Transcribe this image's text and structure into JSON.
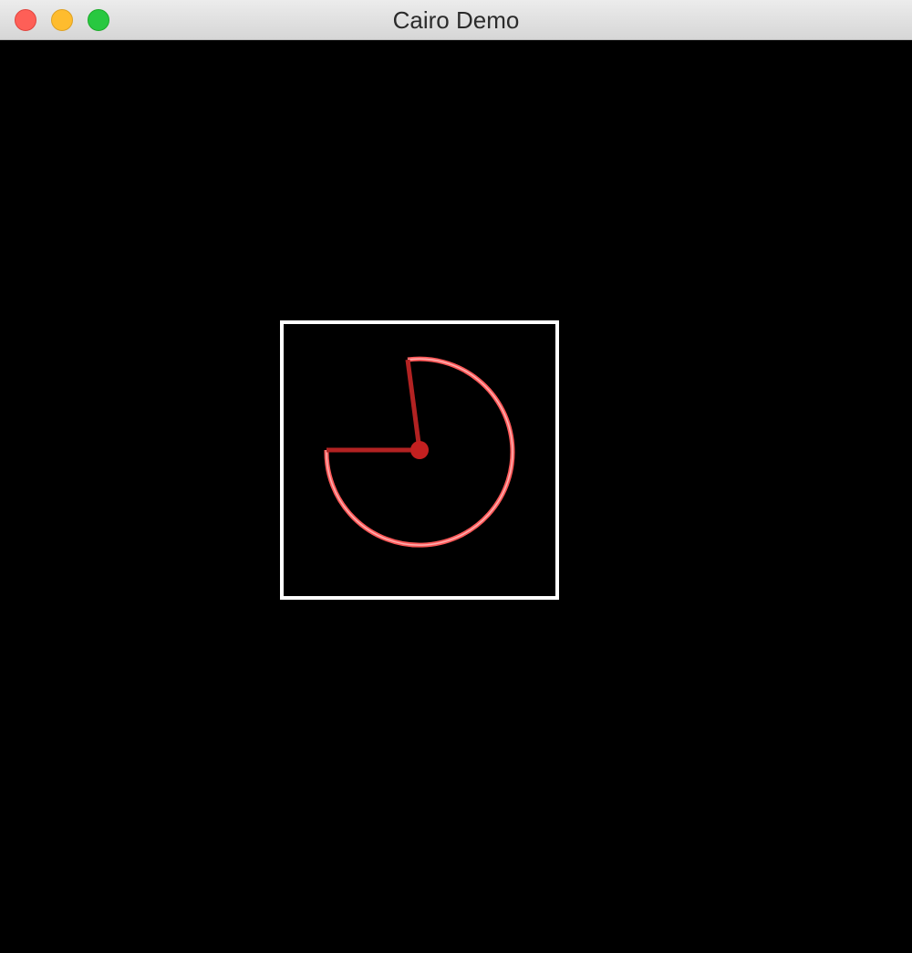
{
  "window": {
    "title": "Cairo Demo"
  },
  "colors": {
    "background": "#000000",
    "frame_stroke": "#ffffff",
    "arc_glow": "#ff5a5a",
    "arc_core": "#ffb0b0",
    "radial_line": "#b22222",
    "center_dot": "#c42020",
    "close": "#fe5f57",
    "minimize": "#febc2e",
    "zoom": "#28c840"
  },
  "icons": {
    "close": "close-traffic-light",
    "minimize": "minimize-traffic-light",
    "zoom": "zoom-traffic-light"
  }
}
